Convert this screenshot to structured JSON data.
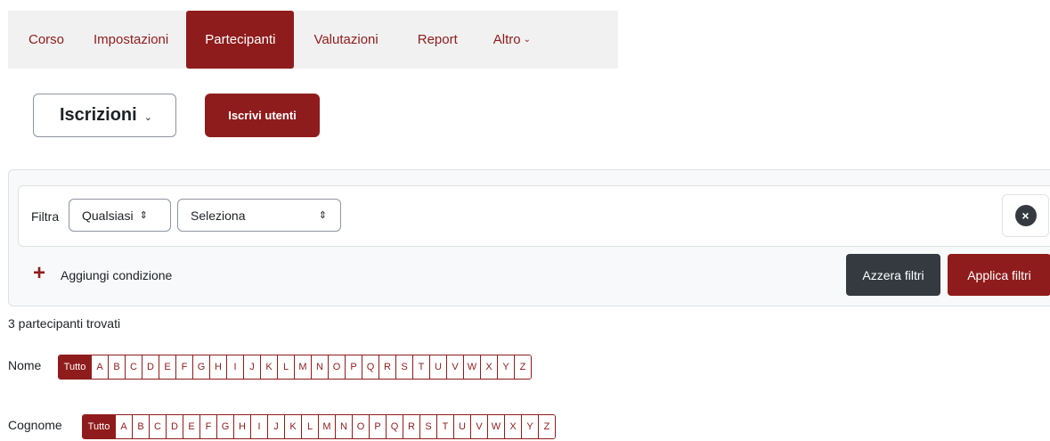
{
  "nav": {
    "tabs": [
      {
        "label": "Corso",
        "active": false
      },
      {
        "label": "Impostazioni",
        "active": false
      },
      {
        "label": "Partecipanti",
        "active": true
      },
      {
        "label": "Valutazioni",
        "active": false
      },
      {
        "label": "Report",
        "active": false
      },
      {
        "label": "Altro",
        "active": false
      }
    ]
  },
  "actions": {
    "page_select": "Iscrizioni",
    "enrol_button": "Iscrivi utenti"
  },
  "filter": {
    "label": "Filtra",
    "match_select": "Qualsiasi",
    "field_select": "Seleziona",
    "add_condition": "Aggiungi condizione",
    "reset_button": "Azzera filtri",
    "apply_button": "Applica filtri"
  },
  "results": {
    "count_text": "3 partecipanti trovati"
  },
  "initials": {
    "first_name_label": "Nome",
    "last_name_label": "Cognome",
    "all_label": "Tutto",
    "letters": [
      "A",
      "B",
      "C",
      "D",
      "E",
      "F",
      "G",
      "H",
      "I",
      "J",
      "K",
      "L",
      "M",
      "N",
      "O",
      "P",
      "Q",
      "R",
      "S",
      "T",
      "U",
      "V",
      "W",
      "X",
      "Y",
      "Z"
    ]
  },
  "colors": {
    "brand": "#8f1c1c",
    "dark_button": "#343a40",
    "panel_bg": "#f8f9fa",
    "nav_bg": "#f1f1f1"
  }
}
